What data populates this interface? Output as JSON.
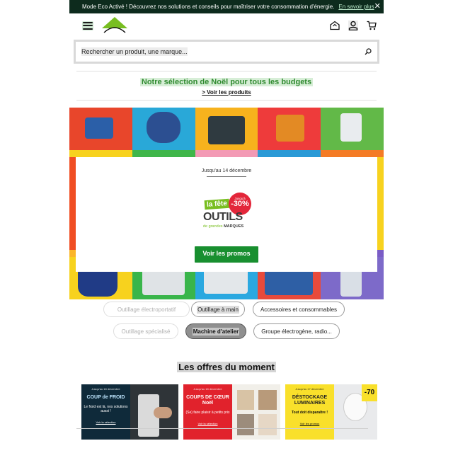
{
  "eco_banner": {
    "message": "Mode Eco Activé ! Découvrez nos solutions et conseils pour maîtriser votre consommation d'énergie.",
    "link": "En savoir plus",
    "close": "✕"
  },
  "header": {
    "logo_text": "LEROY MERLIN",
    "icons": [
      "menu-icon",
      "store-icon",
      "account-icon",
      "cart-icon"
    ]
  },
  "search": {
    "placeholder": "Rechercher un produit, une marque..."
  },
  "promo_banner": {
    "title": "Notre sélection de Noël pour tous les budgets",
    "link": "> Voir les produits"
  },
  "hero": {
    "date": "Jusqu'au 14 décembre",
    "badge_fete": "la fête",
    "badge_upto": "Jusqu'à",
    "badge_discount": "-30%",
    "badge_outils": "OUTILS",
    "badge_marques_prefix": "de grandes",
    "badge_marques": "MARQUES",
    "button": "Voir les promos"
  },
  "categories": [
    {
      "label": "Outillage électroportatif"
    },
    {
      "label": "Outillage à main"
    },
    {
      "label": "Accessoires et consommables"
    },
    {
      "label": "Outillage spécialisé"
    },
    {
      "label": "Machine d'atelier"
    },
    {
      "label": "Groupe électrogène, radio..."
    }
  ],
  "offers": {
    "title": "Les offres du moment",
    "cards": [
      {
        "small": "Jusqu'au 18 décembre",
        "big": "COUP de FROID",
        "body": "Le froid est là, nos solutions aussi !",
        "cta": "Voir la sélection"
      },
      {
        "small": "Jusqu'au 18 décembre",
        "big": "COUPS DE CŒUR Noël",
        "body": "(Se) faire plaisir à petits prix",
        "cta": "Voir la sélection"
      },
      {
        "small": "Jusqu'au 17 décembre",
        "big": "DÉSTOCKAGE LUMINAIRES",
        "body": "Tout doit disparaître !",
        "cta": "Voir les promos",
        "discount": "-70"
      }
    ]
  },
  "colors": {
    "brand_green": "#78be20",
    "button_green": "#188f2f",
    "banner_dark": "#0d2b1d"
  }
}
